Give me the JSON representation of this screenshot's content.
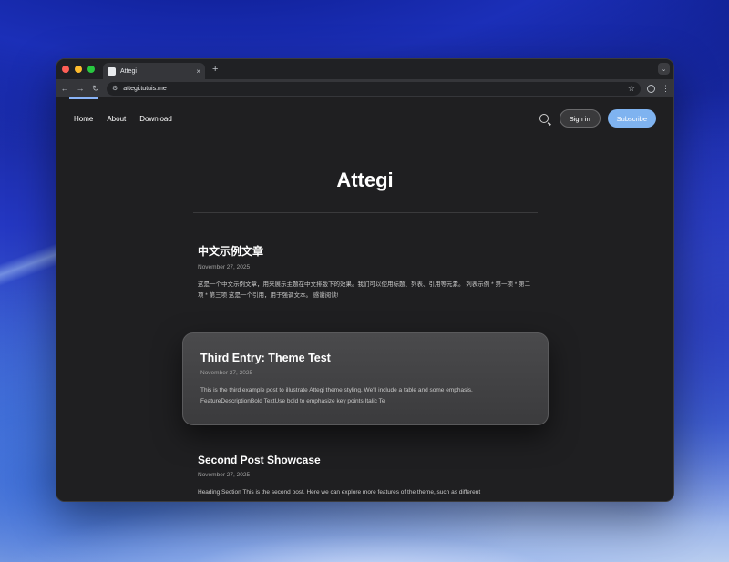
{
  "browser": {
    "tab_title": "Attegi",
    "url": "attegi.tutuis.me",
    "new_tab": "+",
    "tab_close": "×"
  },
  "site": {
    "nav": [
      "Home",
      "About",
      "Download"
    ],
    "signin_label": "Sign in",
    "subscribe_label": "Subscribe",
    "title": "Attegi",
    "accent": "#7fb3f0"
  },
  "posts": [
    {
      "title": "中文示例文章",
      "date": "November 27, 2025",
      "excerpt": "这是一个中文示例文章，用来展示主题在中文排版下的效果。我们可以使用标题、列表、引用等元素。 列表示例 * 第一项 * 第二项 * 第三项 这是一个引用，用于强调文本。 感谢阅读!"
    },
    {
      "title": "Third Entry: Theme Test",
      "date": "November 27, 2025",
      "excerpt": "This is the third example post to illustrate Attegi theme styling. We'll include a table and some emphasis. FeatureDescriptionBold TextUse bold to emphasize key points.Italic Te"
    },
    {
      "title": "Second Post Showcase",
      "date": "November 27, 2025",
      "excerpt": "Heading Section This is the second post. Here we can explore more features of the theme, such as different"
    }
  ]
}
